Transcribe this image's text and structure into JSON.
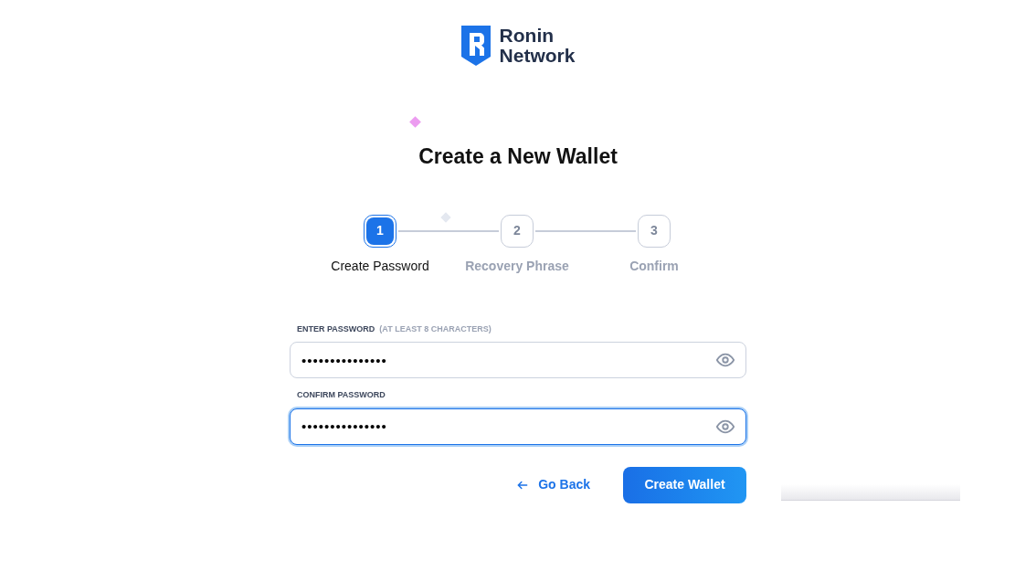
{
  "logo": {
    "line_1": "Ronin",
    "line_2": "Network"
  },
  "title": "Create a New Wallet",
  "steps": [
    {
      "number": "1",
      "label": "Create Password",
      "selected": true
    },
    {
      "number": "2",
      "label": "Recovery Phrase",
      "selected": false
    },
    {
      "number": "3",
      "label": "Confirm",
      "selected": false
    }
  ],
  "fields": [
    {
      "label": "ENTER PASSWORD",
      "hint": "(AT LEAST 8 CHARACTERS)",
      "value": "•••••••••••••••",
      "focused": false
    },
    {
      "label": "CONFIRM PASSWORD",
      "value": "•••••••••••••••",
      "focused": true
    }
  ],
  "buttons": {
    "back": "Go Back",
    "primary": "Create Wallet"
  }
}
